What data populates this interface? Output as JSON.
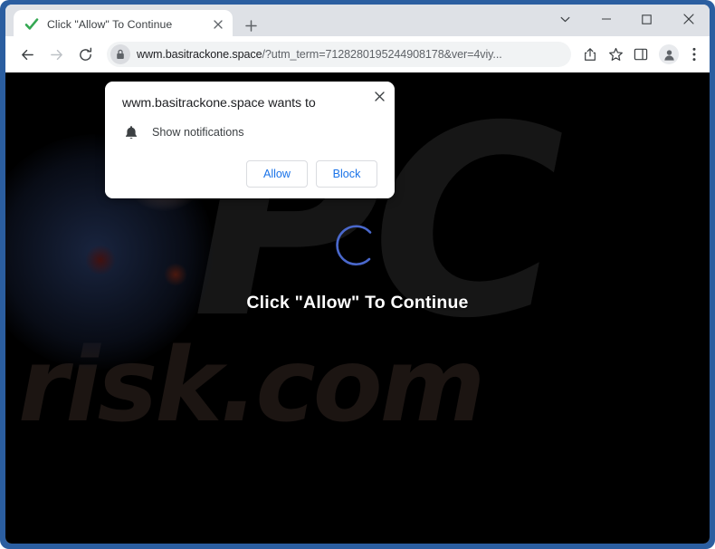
{
  "window": {
    "frame_color": "#2b5ea0",
    "controls": [
      {
        "name": "tab-search",
        "glyph": "chevron-down-icon"
      },
      {
        "name": "minimize",
        "glyph": "minimize-icon"
      },
      {
        "name": "maximize",
        "glyph": "maximize-icon"
      },
      {
        "name": "close",
        "glyph": "close-icon"
      }
    ]
  },
  "tab": {
    "title": "Click \"Allow\" To Continue",
    "favicon": "green-check-icon",
    "close_glyph": "close-icon",
    "newtab_glyph": "plus-icon"
  },
  "toolbar": {
    "back": "back-arrow-icon",
    "forward": "forward-arrow-icon",
    "reload": "reload-icon",
    "site_icon": "lock-icon",
    "url_main": "wwm.basitrackone.space",
    "url_query": "/?utm_term=7128280195244908178&ver=4viy...",
    "url_full": "wwm.basitrackone.space/?utm_term=7128280195244908178&ver=4viy...",
    "icons": [
      {
        "name": "share-icon"
      },
      {
        "name": "bookmark-star-icon"
      },
      {
        "name": "side-panel-icon"
      },
      {
        "name": "profile-avatar-icon"
      },
      {
        "name": "more-menu-icon"
      }
    ]
  },
  "page": {
    "background_color": "#000000",
    "heading": "Click \"Allow\" To Continue",
    "spinner_color": "#4a68cc",
    "watermark_logo": "PC",
    "watermark_domain": "risk.com",
    "watermark_color": "#1a1512"
  },
  "dialog": {
    "title": "wwm.basitrackone.space wants to",
    "permission_icon": "bell-icon",
    "permission_label": "Show notifications",
    "allow_label": "Allow",
    "block_label": "Block",
    "close_glyph": "close-icon",
    "button_text_color": "#1a73e8"
  }
}
